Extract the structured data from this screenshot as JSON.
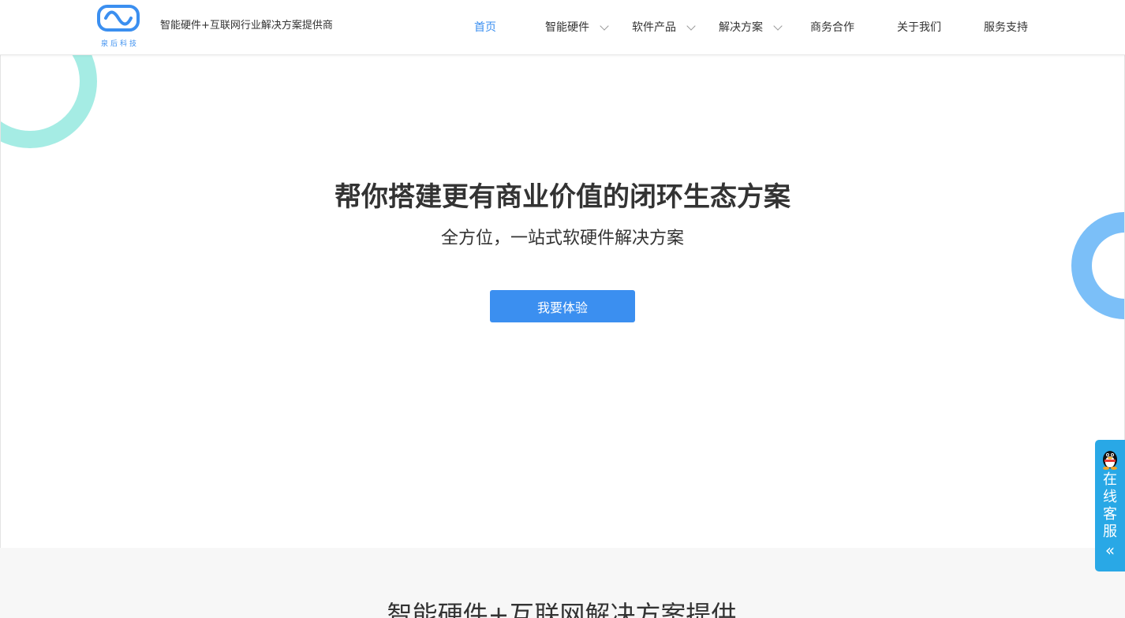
{
  "header": {
    "logo_text": "泉后科技",
    "tagline": "智能硬件+互联网行业解决方案提供商",
    "nav": [
      {
        "label": "首页"
      },
      {
        "label": "智能硬件"
      },
      {
        "label": "软件产品"
      },
      {
        "label": "解决方案"
      },
      {
        "label": "商务合作"
      },
      {
        "label": "关于我们"
      },
      {
        "label": "服务支持"
      }
    ]
  },
  "hero": {
    "title": "帮你搭建更有商业价值的闭环生态方案",
    "subtitle": "全方位，一站式软硬件解决方案",
    "cta_label": "我要体验"
  },
  "section": {
    "title": "智能硬件+互联网解决方案提供"
  },
  "kefu": {
    "label": "在线客服",
    "collapse_glyph": "«"
  },
  "colors": {
    "accent": "#3b8ff0",
    "ring_teal": "#a5ece4",
    "ring_blue": "#7bbff8",
    "kefu": "#29a8e6"
  }
}
